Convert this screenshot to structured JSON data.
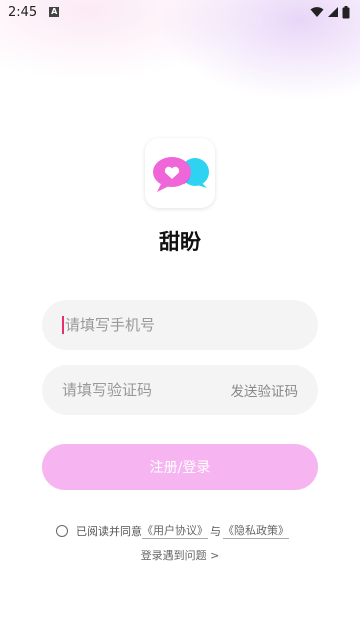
{
  "status_bar": {
    "time": "2:45",
    "notification_glyph": "A",
    "icons": [
      "wifi-icon",
      "signal-icon",
      "battery-icon"
    ]
  },
  "app": {
    "name": "甜盼",
    "logo_icon": "chat-bubble-heart-icon",
    "colors": {
      "pink": "#ef66d8",
      "cyan": "#2fd3f2",
      "purple": "#7a4fe0"
    }
  },
  "form": {
    "phone_placeholder": "请填写手机号",
    "code_placeholder": "请填写验证码",
    "send_code_label": "发送验证码",
    "submit_label": "注册/登录",
    "submit_color": "#f6b4f1"
  },
  "agreement": {
    "prefix": "已阅读并同意",
    "user_agreement": "《用户协议》",
    "and": "与",
    "privacy_policy": "《隐私政策》"
  },
  "help": {
    "label": "登录遇到问题 >"
  }
}
